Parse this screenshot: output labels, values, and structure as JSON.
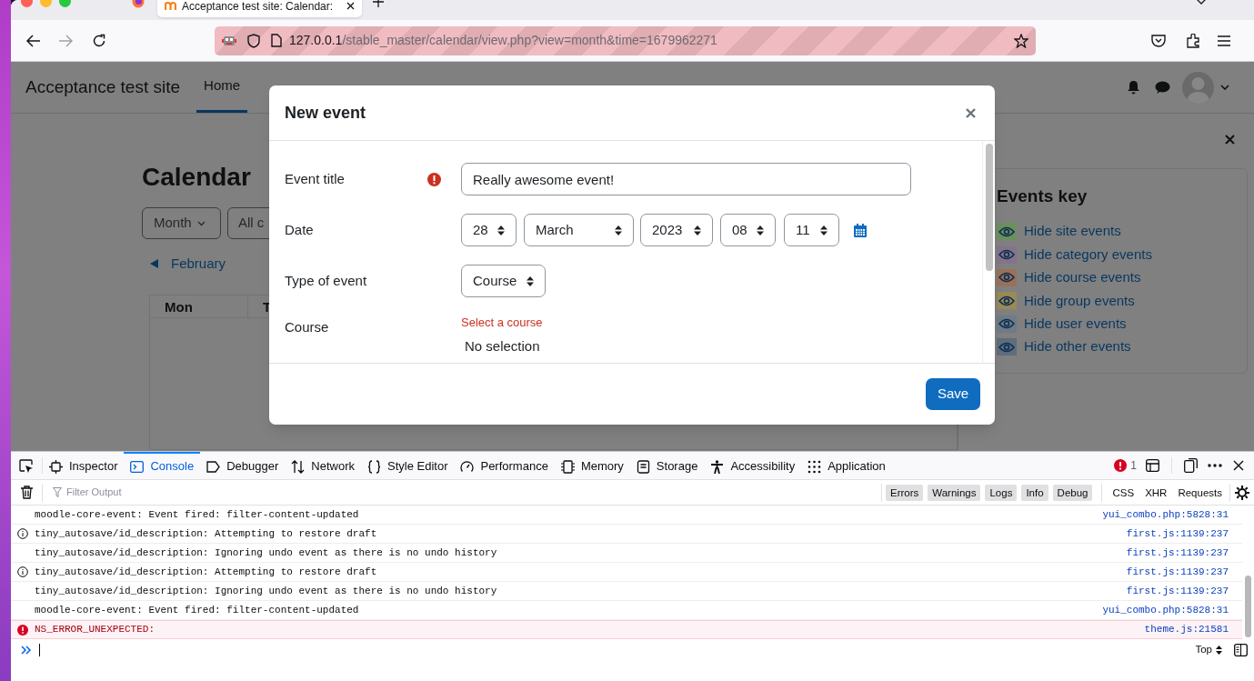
{
  "browser": {
    "tab_title": "Acceptance test site: Calendar: ",
    "url_host": "127.0.0.1",
    "url_path": "/stable_master/calendar/view.php?view=month&time=1679962271"
  },
  "site": {
    "name": "Acceptance test site",
    "nav": [
      {
        "label": "Home",
        "selected": true
      }
    ]
  },
  "calendar": {
    "heading": "Calendar",
    "view_button": "Month",
    "course_button": "All c",
    "prev_month": "February",
    "columns": [
      "Mon",
      "T"
    ]
  },
  "events_key": {
    "title": "Events key",
    "items": [
      {
        "label": "Hide site events",
        "color": "#6b8f5e"
      },
      {
        "label": "Hide category events",
        "color": "#86738b"
      },
      {
        "label": "Hide course events",
        "color": "#9b7158"
      },
      {
        "label": "Hide group events",
        "color": "#9a8a55"
      },
      {
        "label": "Hide user events",
        "color": "#6f7b86"
      },
      {
        "label": "Hide other events",
        "color": "#5f6d7c"
      }
    ]
  },
  "modal": {
    "title": "New event",
    "fields": [
      {
        "kind": "text",
        "label": "Event title",
        "error_icon": true,
        "value": "Really awesome event!"
      },
      {
        "kind": "date",
        "label": "Date",
        "parts": [
          "28",
          "March",
          "2023",
          "08",
          "11"
        ]
      },
      {
        "kind": "select",
        "label": "Type of event",
        "value": "Course"
      },
      {
        "kind": "autocomplete",
        "label": "Course",
        "error": "Select a course",
        "value": "No selection"
      }
    ],
    "save_button": "Save"
  },
  "devtools": {
    "tabs": [
      {
        "label": "Inspector",
        "selected": false
      },
      {
        "label": "Console",
        "selected": true
      },
      {
        "label": "Debugger",
        "selected": false
      },
      {
        "label": "Network",
        "selected": false
      },
      {
        "label": "Style Editor",
        "selected": false
      },
      {
        "label": "Performance",
        "selected": false
      },
      {
        "label": "Memory",
        "selected": false
      },
      {
        "label": "Storage",
        "selected": false
      },
      {
        "label": "Accessibility",
        "selected": false
      },
      {
        "label": "Application",
        "selected": false
      }
    ],
    "error_count": "1",
    "filter_placeholder": "Filter Output",
    "level_filters": [
      "Errors",
      "Warnings",
      "Logs",
      "Info",
      "Debug"
    ],
    "type_filters": [
      "CSS",
      "XHR",
      "Requests"
    ],
    "messages": [
      {
        "kind": "log",
        "text": "moodle-core-event: Event fired: filter-content-updated",
        "source": "yui_combo.php:5828:31"
      },
      {
        "kind": "info",
        "text": "tiny_autosave/id_description: Attempting to restore draft",
        "source": "first.js:1139:237"
      },
      {
        "kind": "log",
        "text": "tiny_autosave/id_description: Ignoring undo event as there is no undo history",
        "source": "first.js:1139:237"
      },
      {
        "kind": "info",
        "text": "tiny_autosave/id_description: Attempting to restore draft",
        "source": "first.js:1139:237"
      },
      {
        "kind": "log",
        "text": "tiny_autosave/id_description: Ignoring undo event as there is no undo history",
        "source": "first.js:1139:237"
      },
      {
        "kind": "log",
        "text": "moodle-core-event: Event fired: filter-content-updated",
        "source": "yui_combo.php:5828:31"
      },
      {
        "kind": "error",
        "text": "NS_ERROR_UNEXPECTED:",
        "source": "theme.js:21581"
      }
    ],
    "context": "Top"
  }
}
